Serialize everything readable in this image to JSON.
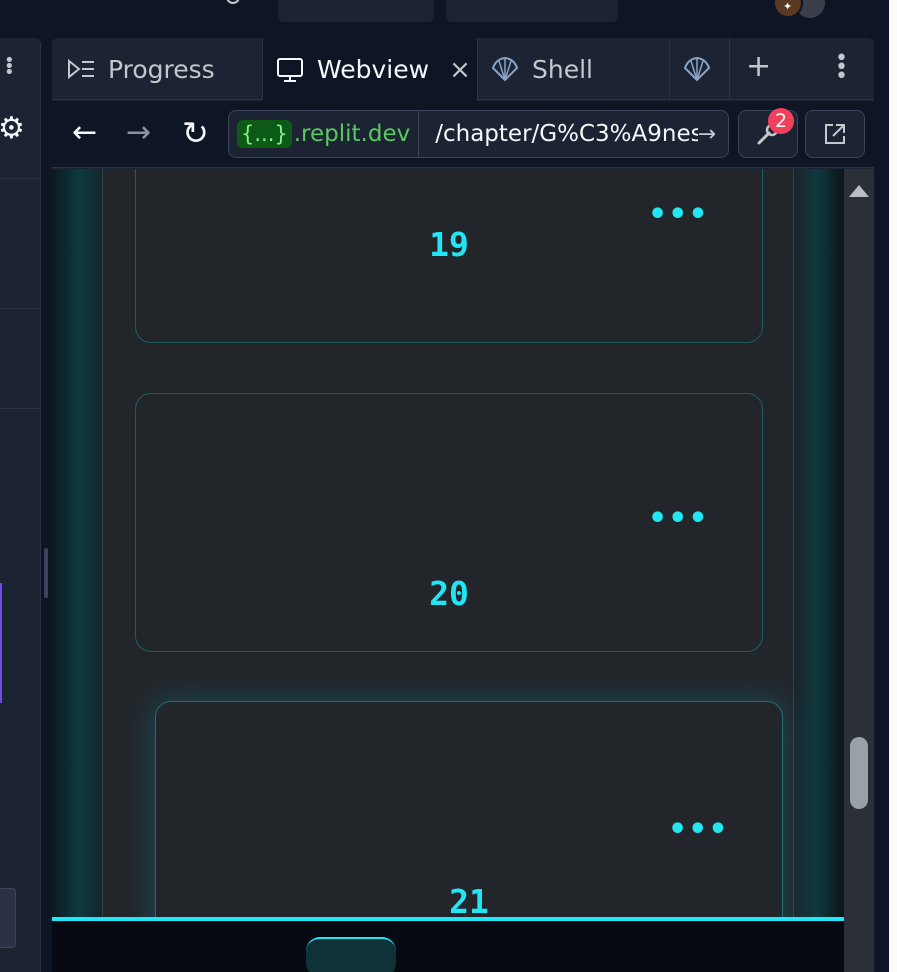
{
  "tabs": [
    {
      "label": "Progress",
      "icon": "progress-icon",
      "active": false
    },
    {
      "label": "Webview",
      "icon": "monitor-icon",
      "active": true,
      "close": "×"
    },
    {
      "label": "Shell",
      "icon": "shell-icon",
      "active": false
    },
    {
      "label": "",
      "icon": "shell-icon",
      "active": false
    }
  ],
  "tabbar": {
    "add_label": "+",
    "more_label": "⋮"
  },
  "urlbar": {
    "back": "←",
    "forward": "→",
    "reload": "↻",
    "host_chip": "{...}",
    "host_domain": ".replit.dev",
    "path": "/chapter/G%C3%A9nes",
    "go": "→",
    "devtools_badge": "2"
  },
  "cards": [
    {
      "number": "19",
      "dots": "•••"
    },
    {
      "number": "20",
      "dots": "•••"
    },
    {
      "number": "21",
      "dots": "•••"
    }
  ],
  "colors": {
    "accent": "#1fe7f5",
    "card_border": "#1d5e62",
    "badge": "#f23f5c",
    "host_green": "#58c95e"
  }
}
